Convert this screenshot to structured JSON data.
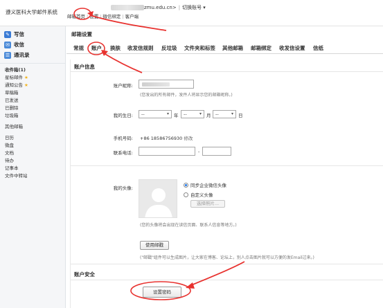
{
  "header": {
    "brand": "遵义医科大学邮件系统",
    "account_domain": "zmu.edu.cn>",
    "switch_label": "切换账号 ▾",
    "links": [
      "邮箱首页",
      "设置",
      "微信绑定",
      "客户端"
    ]
  },
  "sidebar": {
    "primary": [
      {
        "label": "写信",
        "icon": "compose-icon",
        "color": "#3a7bd5"
      },
      {
        "label": "收信",
        "icon": "inbox-icon",
        "color": "#3a7bd5"
      },
      {
        "label": "通讯录",
        "icon": "contacts-icon",
        "color": "#3a7bd5"
      }
    ],
    "folders": [
      "收件箱(1)",
      "星标邮件",
      "通知公告",
      "草稿箱",
      "已发送",
      "已删除",
      "垃圾箱"
    ],
    "other": [
      "其他邮箱"
    ],
    "tools": [
      "日历",
      "微盘",
      "文档",
      "待办",
      "记事本",
      "文件中转站"
    ]
  },
  "main": {
    "title": "邮箱设置",
    "tabs": [
      "常规",
      "账户",
      "换肤",
      "收发信规则",
      "反垃圾",
      "文件夹和标签",
      "其他邮箱",
      "邮箱绑定",
      "收发信设置",
      "信纸"
    ],
    "account_info": {
      "heading": "账户信息",
      "nickname_label": "账户昵称:",
      "nickname_hint": "(您发出的所有邮件，发件人将显示您的邮箱昵称。)",
      "birthday_label": "我的生日:",
      "birthday_selects": [
        "--",
        "--",
        "--"
      ],
      "birthday_units": [
        "年",
        "月",
        "日"
      ],
      "phone_label": "手机号码:",
      "phone_value": "+86 18586756930",
      "phone_edit": "修改",
      "tel_label": "联系电话:",
      "tel_sep": "-",
      "avatar_label": "我的头像:",
      "radio_sync": "同步企业微信头像",
      "radio_custom": "自定义头像",
      "choose_photo": "选择照片...",
      "avatar_hint": "(您的头像将会出现在读信页面、联系人信息等地方。)",
      "stamp_button": "使用邮戳",
      "stamp_hint": "(\"邮戳\"组件可以生成图片，让大家在博客、论坛上，别人点击图片就可以方便的发Email过来。)"
    },
    "security": {
      "heading": "账户安全",
      "set_password": "设置密码"
    }
  },
  "colors": {
    "annotation": "#e8322f",
    "radio_selected": "#1a73e8",
    "star": "#f2b31d"
  }
}
